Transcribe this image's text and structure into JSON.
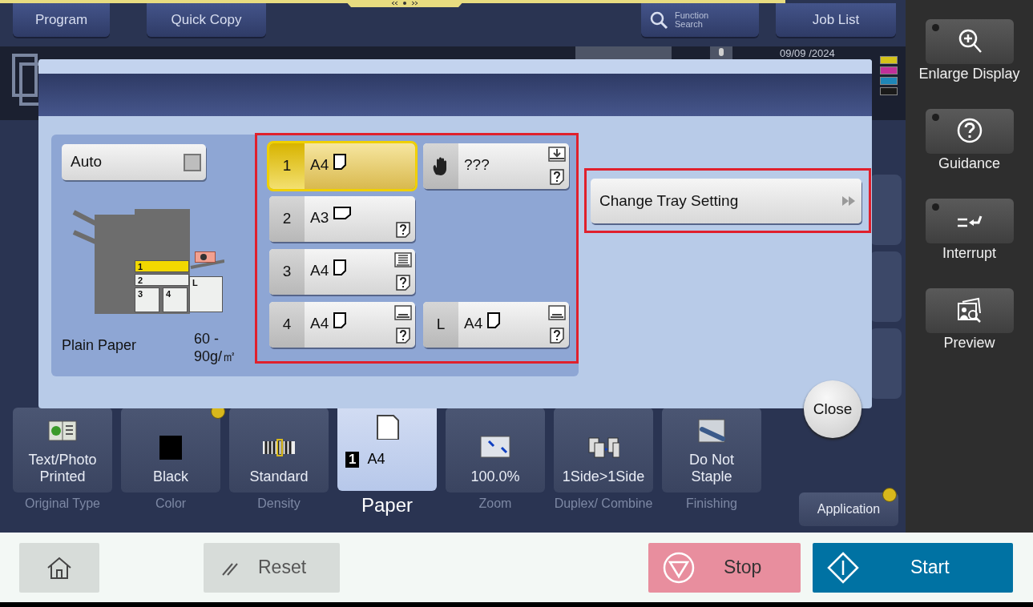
{
  "top_buttons": [
    {
      "label": "Program",
      "kind": "plain"
    },
    {
      "label": "Quick Copy",
      "kind": "plain"
    },
    {
      "label": "Function Search",
      "kind": "search"
    },
    {
      "label": "Job List",
      "kind": "plain"
    }
  ],
  "status": {
    "date": "09/09 /2024",
    "toner": [
      {
        "color": "#d4c21a"
      },
      {
        "color": "#c0309a"
      },
      {
        "color": "#1f86b8"
      },
      {
        "color": "#1a1a1a"
      }
    ]
  },
  "dialog": {
    "auto": {
      "label": "Auto",
      "checked": false
    },
    "slots": [
      {
        "label": "1",
        "selected": true
      },
      {
        "label": "2",
        "selected": false
      },
      {
        "label": "3",
        "selected": false
      },
      {
        "label": "4",
        "selected": false
      },
      {
        "label": "L",
        "selected": false
      }
    ],
    "paper_type": "Plain Paper",
    "weight": "60 - 90g/㎡",
    "trays": [
      {
        "kind": "tray",
        "number": "1",
        "size": "A4",
        "paper": {
          "kind": "portrait"
        },
        "unknown_type": false,
        "selected": true
      },
      {
        "kind": "bypass",
        "size": "???",
        "stack": {
          "kind": "in"
        },
        "unknown_type": true,
        "selected": false
      },
      {
        "kind": "tray",
        "number": "2",
        "size": "A3",
        "paper": {
          "kind": "landscape"
        },
        "unknown_type": true,
        "selected": false
      },
      {
        "kind": "tray",
        "number": "3",
        "size": "A4",
        "paper": {
          "kind": "portrait"
        },
        "stack": {
          "kind": "full"
        },
        "unknown_type": true,
        "selected": false
      },
      {
        "kind": "tray",
        "number": "4",
        "size": "A4",
        "paper": {
          "kind": "portrait"
        },
        "stack": {
          "kind": "low"
        },
        "unknown_type": true,
        "selected": false
      },
      {
        "kind": "tray",
        "number": "L",
        "size": "A4",
        "paper": {
          "kind": "portrait"
        },
        "stack": {
          "kind": "low"
        },
        "unknown_type": true,
        "selected": false
      }
    ],
    "action": "Change Tray Setting",
    "close": "Close"
  },
  "functions": [
    {
      "kind": "original",
      "value": "Text/Photo Printed",
      "caption": "Original Type",
      "indicator": false,
      "selected": false
    },
    {
      "kind": "color",
      "value": "Black",
      "caption": "Color",
      "indicator": true,
      "selected": false
    },
    {
      "kind": "density",
      "value": "Standard",
      "caption": "Density",
      "indicator": false,
      "selected": false
    },
    {
      "kind": "paper",
      "tray": "1",
      "value": "A4",
      "caption": "Paper",
      "indicator": false,
      "selected": true
    },
    {
      "kind": "zoom",
      "value": "100.0%",
      "caption": "Zoom",
      "indicator": false,
      "selected": false
    },
    {
      "kind": "duplex",
      "value": "1Side>1Side",
      "caption": "Duplex/ Combine",
      "indicator": false,
      "selected": false
    },
    {
      "kind": "finishing",
      "value": "Do Not Staple",
      "caption": "Finishing",
      "indicator": false,
      "selected": false
    }
  ],
  "application": {
    "label": "Application",
    "indicator": true
  },
  "sidebar": [
    {
      "kind": "enlarge",
      "label": "Enlarge Display",
      "lamp": true
    },
    {
      "kind": "guidance",
      "label": "Guidance",
      "lamp": true
    },
    {
      "kind": "interrupt",
      "label": "Interrupt",
      "lamp": true
    },
    {
      "kind": "preview",
      "label": "Preview",
      "lamp": false
    }
  ],
  "bottom": {
    "reset": "Reset",
    "stop": "Stop",
    "start": "Start"
  }
}
